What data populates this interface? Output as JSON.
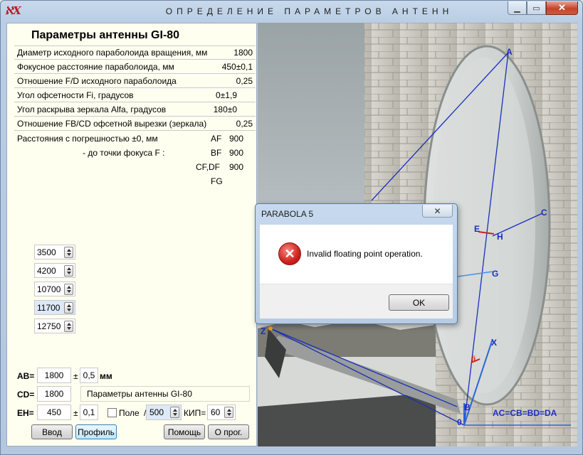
{
  "window": {
    "title": "ОПРЕДЕЛЕНИЕ ПАРАМЕТРОВ АНТЕНН",
    "app_icon": "ℵX",
    "minimize_glyph": "▁",
    "maximize_glyph": "▭",
    "close_glyph": "✕"
  },
  "panel": {
    "title": "Параметры  антенны  GI-80",
    "params": [
      {
        "label": "Диаметр исходного параболоида вращения, мм",
        "value": "1800"
      },
      {
        "label": "Фокусное  расстояние  параболоида, мм",
        "value": "450±0,1"
      },
      {
        "label": "Отношение  F/D  исходного  параболоида",
        "value": "0,25"
      },
      {
        "label": "Угол  офсетности Fi, градусов",
        "value": "0±1,9"
      },
      {
        "label": "Угол  раскрыва  зеркала  Alfa, градусов",
        "value": "180±0"
      },
      {
        "label": "Отношение  FB/CD офсетной вырезки (зеркала)",
        "value": "0,25"
      }
    ],
    "distances": {
      "line1": "Расстояния с погрешностью ±0, мм",
      "line2": "- до точки фокуса F :",
      "labels": [
        "AF",
        "BF",
        "CF,DF",
        "FG"
      ],
      "values": [
        "900",
        "900",
        "900",
        ""
      ]
    }
  },
  "frequencies": [
    "3500",
    "4200",
    "10700",
    "11700",
    "12750"
  ],
  "form": {
    "ab_label": "AB=",
    "ab_value": "1800",
    "pm1": "±",
    "ab_tol": "0,5",
    "mm": "мм",
    "cd_label": "CD=",
    "cd_value": "1800",
    "cd_name": "Параметры  антенны  GI-80",
    "eh_label": "EH=",
    "eh_value": "450",
    "pm2": "±",
    "eh_tol": "0,1",
    "field_label": "Поле",
    "slash": "/",
    "field_value": "500",
    "kip_label": "КИП=",
    "kip_value": "60"
  },
  "buttons": {
    "input": "Ввод",
    "profile": "Профиль",
    "help": "Помощь",
    "about": "О прог."
  },
  "photo_labels": {
    "A": "A",
    "C": "C",
    "E": "E",
    "H": "H",
    "G": "G",
    "Z": "Z",
    "X": "X",
    "B": "B",
    "O": "0",
    "fi": "fi",
    "equation": "AC=CB=BD=DA"
  },
  "dialog": {
    "title": "PARABOLA 5",
    "close_glyph": "✕",
    "message": "Invalid floating point operation.",
    "ok": "OK",
    "icon_glyph": "✕"
  },
  "colors": {
    "panel_bg": "#fffff0",
    "accent_line": "#1a2fbf",
    "error_red": "#d0211b"
  }
}
